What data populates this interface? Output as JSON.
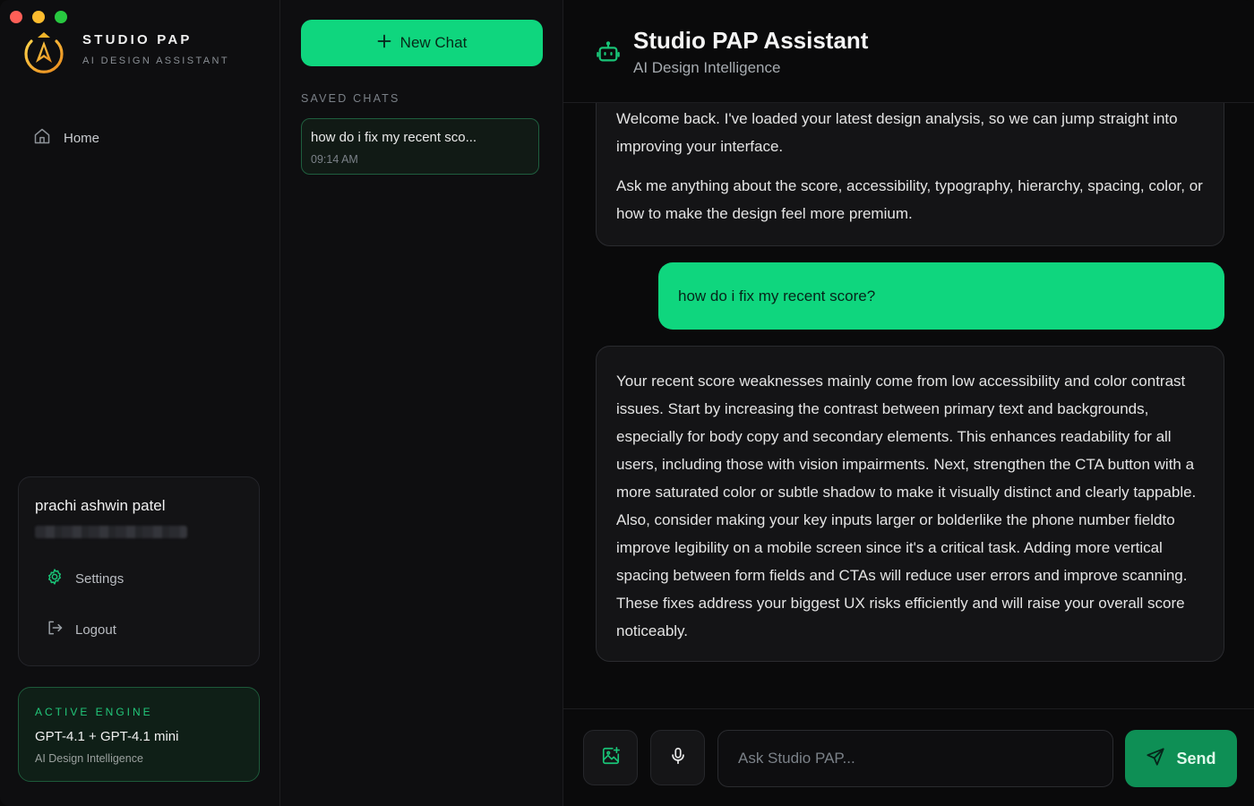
{
  "window": {
    "controls": [
      "close",
      "minimize",
      "maximize"
    ]
  },
  "brand": {
    "name": "STUDIO PAP",
    "subtitle": "AI DESIGN ASSISTANT",
    "logo_icon": "compass-a-logo",
    "accent": "#f5a623"
  },
  "sidebar": {
    "nav": [
      {
        "label": "Home",
        "icon": "home-icon"
      }
    ],
    "user": {
      "name": "prachi ashwin patel",
      "menu": [
        {
          "label": "Settings",
          "icon": "gear-icon"
        },
        {
          "label": "Logout",
          "icon": "logout-icon"
        }
      ]
    },
    "engine": {
      "label": "ACTIVE ENGINE",
      "name": "GPT-4.1 + GPT-4.1 mini",
      "subtitle": "AI Design Intelligence"
    }
  },
  "chats": {
    "new_chat_label": "New Chat",
    "saved_label": "SAVED CHATS",
    "items": [
      {
        "title": "how do i fix my recent sco...",
        "time": "09:14 AM"
      }
    ]
  },
  "main": {
    "title": "Studio PAP Assistant",
    "subtitle": "AI Design Intelligence",
    "messages": [
      {
        "role": "assistant",
        "paragraphs": [
          "Welcome back. I've loaded your latest design analysis, so we can jump straight into improving your interface.",
          "Ask me anything about the score, accessibility, typography, hierarchy, spacing, color, or how to make the design feel more premium."
        ]
      },
      {
        "role": "user",
        "text": "how do i fix my recent score?"
      },
      {
        "role": "assistant",
        "text": "Your recent score weaknesses mainly come from low accessibility and color contrast issues. Start by increasing the contrast between primary text and backgrounds, especially for body copy and secondary elements. This enhances readability for all users, including those with vision impairments. Next, strengthen the CTA button with a more saturated color or subtle shadow to make it visually distinct and clearly tappable. Also, consider making your key inputs larger or bolderlike the phone number fieldto improve legibility on a mobile screen since it's a critical task. Adding more vertical spacing between form fields and CTAs will reduce user errors and improve scanning. These fixes address your biggest UX risks efficiently and will raise your overall score noticeably."
      }
    ],
    "composer": {
      "placeholder": "Ask Studio PAP...",
      "send_label": "Send"
    }
  },
  "colors": {
    "primary": "#0fd67e",
    "send": "#0e8f55",
    "background": "#0a0a0b",
    "panel": "#0e0e10"
  }
}
